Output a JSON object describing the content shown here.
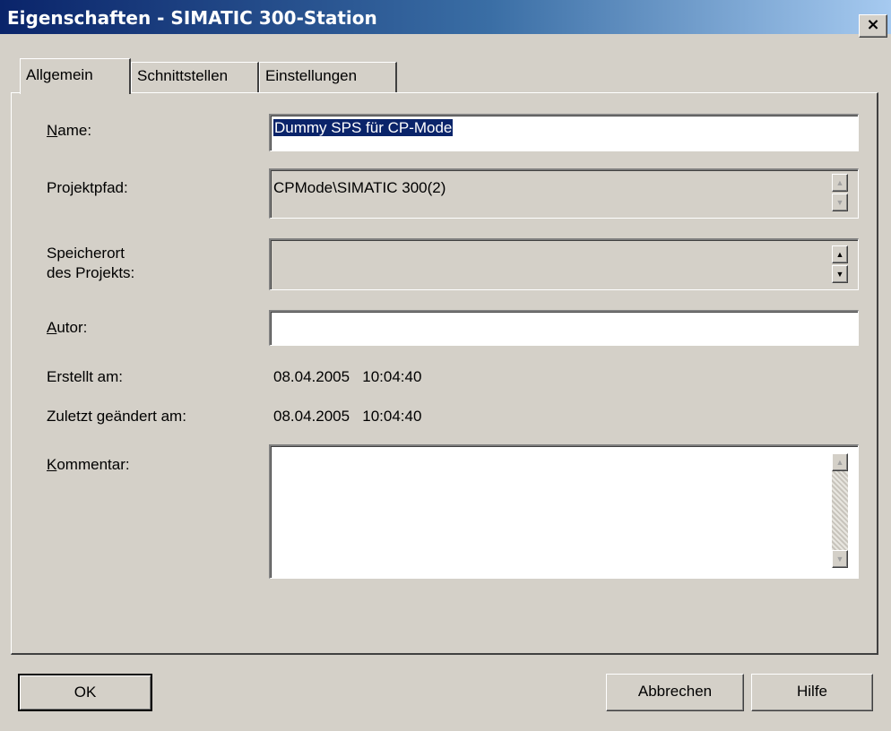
{
  "window": {
    "title": "Eigenschaften - SIMATIC 300-Station",
    "close_glyph": "×"
  },
  "tabs": [
    {
      "label": "Allgemein",
      "active": true
    },
    {
      "label": "Schnittstellen",
      "active": false
    },
    {
      "label": "Einstellungen",
      "active": false
    }
  ],
  "form": {
    "name_label_key": "N",
    "name_label_rest": "ame:",
    "name_value": "Dummy SPS für CP-Mode",
    "projektpfad_label": "Projektpfad:",
    "projektpfad_value": "CPMode\\SIMATIC 300(2)",
    "speicherort_label_line1": "Speicherort",
    "speicherort_label_line2": "des Projekts:",
    "speicherort_value": "",
    "autor_label_key": "A",
    "autor_label_rest": "utor:",
    "autor_value": "",
    "erstellt_label": "Erstellt am:",
    "erstellt_value": "08.04.2005   10:04:40",
    "geaendert_label": "Zuletzt geändert am:",
    "geaendert_value": "08.04.2005   10:04:40",
    "kommentar_label_key": "K",
    "kommentar_label_rest": "ommentar:",
    "kommentar_value": ""
  },
  "buttons": {
    "ok": "OK",
    "cancel": "Abbrechen",
    "help": "Hilfe"
  },
  "glyphs": {
    "up": "▲",
    "down": "▼"
  },
  "colors": {
    "title_start": "#0a246a",
    "title_end": "#a6caf0",
    "face": "#d4d0c8",
    "selection": "#0a246a"
  }
}
